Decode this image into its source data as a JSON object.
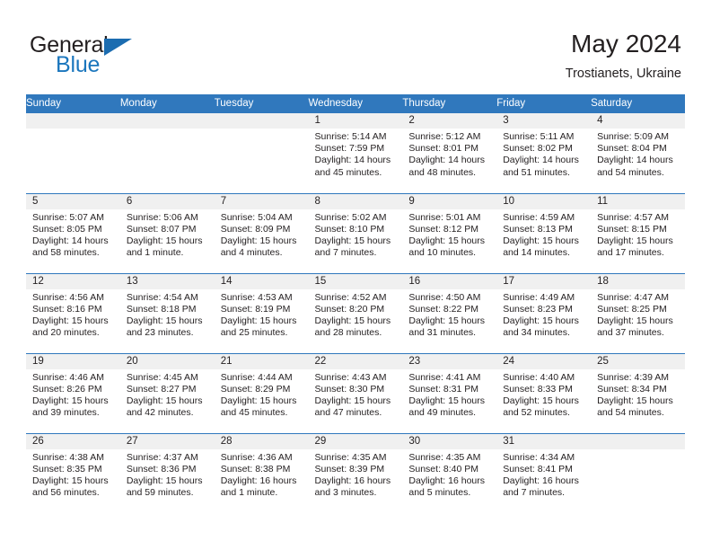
{
  "brand": {
    "name_part1": "General",
    "name_part2": "Blue",
    "flag_icon": "triangle-flag-icon"
  },
  "header": {
    "title": "May 2024",
    "location": "Trostianets, Ukraine"
  },
  "colors": {
    "header_blue": "#3078bd",
    "brand_blue": "#1b76bd",
    "daynum_gray": "#f0f0f0",
    "text": "#231f20"
  },
  "labels": {
    "sunrise_prefix": "Sunrise:",
    "sunset_prefix": "Sunset:",
    "daylight_prefix": "Daylight:"
  },
  "columns": [
    "Sunday",
    "Monday",
    "Tuesday",
    "Wednesday",
    "Thursday",
    "Friday",
    "Saturday"
  ],
  "weeks": [
    [
      {
        "day": "",
        "empty": true
      },
      {
        "day": "",
        "empty": true
      },
      {
        "day": "",
        "empty": true
      },
      {
        "day": "1",
        "sunrise": "Sunrise: 5:14 AM",
        "sunset": "Sunset: 7:59 PM",
        "daylight1": "Daylight: 14 hours",
        "daylight2": "and 45 minutes."
      },
      {
        "day": "2",
        "sunrise": "Sunrise: 5:12 AM",
        "sunset": "Sunset: 8:01 PM",
        "daylight1": "Daylight: 14 hours",
        "daylight2": "and 48 minutes."
      },
      {
        "day": "3",
        "sunrise": "Sunrise: 5:11 AM",
        "sunset": "Sunset: 8:02 PM",
        "daylight1": "Daylight: 14 hours",
        "daylight2": "and 51 minutes."
      },
      {
        "day": "4",
        "sunrise": "Sunrise: 5:09 AM",
        "sunset": "Sunset: 8:04 PM",
        "daylight1": "Daylight: 14 hours",
        "daylight2": "and 54 minutes."
      }
    ],
    [
      {
        "day": "5",
        "sunrise": "Sunrise: 5:07 AM",
        "sunset": "Sunset: 8:05 PM",
        "daylight1": "Daylight: 14 hours",
        "daylight2": "and 58 minutes."
      },
      {
        "day": "6",
        "sunrise": "Sunrise: 5:06 AM",
        "sunset": "Sunset: 8:07 PM",
        "daylight1": "Daylight: 15 hours",
        "daylight2": "and 1 minute."
      },
      {
        "day": "7",
        "sunrise": "Sunrise: 5:04 AM",
        "sunset": "Sunset: 8:09 PM",
        "daylight1": "Daylight: 15 hours",
        "daylight2": "and 4 minutes."
      },
      {
        "day": "8",
        "sunrise": "Sunrise: 5:02 AM",
        "sunset": "Sunset: 8:10 PM",
        "daylight1": "Daylight: 15 hours",
        "daylight2": "and 7 minutes."
      },
      {
        "day": "9",
        "sunrise": "Sunrise: 5:01 AM",
        "sunset": "Sunset: 8:12 PM",
        "daylight1": "Daylight: 15 hours",
        "daylight2": "and 10 minutes."
      },
      {
        "day": "10",
        "sunrise": "Sunrise: 4:59 AM",
        "sunset": "Sunset: 8:13 PM",
        "daylight1": "Daylight: 15 hours",
        "daylight2": "and 14 minutes."
      },
      {
        "day": "11",
        "sunrise": "Sunrise: 4:57 AM",
        "sunset": "Sunset: 8:15 PM",
        "daylight1": "Daylight: 15 hours",
        "daylight2": "and 17 minutes."
      }
    ],
    [
      {
        "day": "12",
        "sunrise": "Sunrise: 4:56 AM",
        "sunset": "Sunset: 8:16 PM",
        "daylight1": "Daylight: 15 hours",
        "daylight2": "and 20 minutes."
      },
      {
        "day": "13",
        "sunrise": "Sunrise: 4:54 AM",
        "sunset": "Sunset: 8:18 PM",
        "daylight1": "Daylight: 15 hours",
        "daylight2": "and 23 minutes."
      },
      {
        "day": "14",
        "sunrise": "Sunrise: 4:53 AM",
        "sunset": "Sunset: 8:19 PM",
        "daylight1": "Daylight: 15 hours",
        "daylight2": "and 25 minutes."
      },
      {
        "day": "15",
        "sunrise": "Sunrise: 4:52 AM",
        "sunset": "Sunset: 8:20 PM",
        "daylight1": "Daylight: 15 hours",
        "daylight2": "and 28 minutes."
      },
      {
        "day": "16",
        "sunrise": "Sunrise: 4:50 AM",
        "sunset": "Sunset: 8:22 PM",
        "daylight1": "Daylight: 15 hours",
        "daylight2": "and 31 minutes."
      },
      {
        "day": "17",
        "sunrise": "Sunrise: 4:49 AM",
        "sunset": "Sunset: 8:23 PM",
        "daylight1": "Daylight: 15 hours",
        "daylight2": "and 34 minutes."
      },
      {
        "day": "18",
        "sunrise": "Sunrise: 4:47 AM",
        "sunset": "Sunset: 8:25 PM",
        "daylight1": "Daylight: 15 hours",
        "daylight2": "and 37 minutes."
      }
    ],
    [
      {
        "day": "19",
        "sunrise": "Sunrise: 4:46 AM",
        "sunset": "Sunset: 8:26 PM",
        "daylight1": "Daylight: 15 hours",
        "daylight2": "and 39 minutes."
      },
      {
        "day": "20",
        "sunrise": "Sunrise: 4:45 AM",
        "sunset": "Sunset: 8:27 PM",
        "daylight1": "Daylight: 15 hours",
        "daylight2": "and 42 minutes."
      },
      {
        "day": "21",
        "sunrise": "Sunrise: 4:44 AM",
        "sunset": "Sunset: 8:29 PM",
        "daylight1": "Daylight: 15 hours",
        "daylight2": "and 45 minutes."
      },
      {
        "day": "22",
        "sunrise": "Sunrise: 4:43 AM",
        "sunset": "Sunset: 8:30 PM",
        "daylight1": "Daylight: 15 hours",
        "daylight2": "and 47 minutes."
      },
      {
        "day": "23",
        "sunrise": "Sunrise: 4:41 AM",
        "sunset": "Sunset: 8:31 PM",
        "daylight1": "Daylight: 15 hours",
        "daylight2": "and 49 minutes."
      },
      {
        "day": "24",
        "sunrise": "Sunrise: 4:40 AM",
        "sunset": "Sunset: 8:33 PM",
        "daylight1": "Daylight: 15 hours",
        "daylight2": "and 52 minutes."
      },
      {
        "day": "25",
        "sunrise": "Sunrise: 4:39 AM",
        "sunset": "Sunset: 8:34 PM",
        "daylight1": "Daylight: 15 hours",
        "daylight2": "and 54 minutes."
      }
    ],
    [
      {
        "day": "26",
        "sunrise": "Sunrise: 4:38 AM",
        "sunset": "Sunset: 8:35 PM",
        "daylight1": "Daylight: 15 hours",
        "daylight2": "and 56 minutes."
      },
      {
        "day": "27",
        "sunrise": "Sunrise: 4:37 AM",
        "sunset": "Sunset: 8:36 PM",
        "daylight1": "Daylight: 15 hours",
        "daylight2": "and 59 minutes."
      },
      {
        "day": "28",
        "sunrise": "Sunrise: 4:36 AM",
        "sunset": "Sunset: 8:38 PM",
        "daylight1": "Daylight: 16 hours",
        "daylight2": "and 1 minute."
      },
      {
        "day": "29",
        "sunrise": "Sunrise: 4:35 AM",
        "sunset": "Sunset: 8:39 PM",
        "daylight1": "Daylight: 16 hours",
        "daylight2": "and 3 minutes."
      },
      {
        "day": "30",
        "sunrise": "Sunrise: 4:35 AM",
        "sunset": "Sunset: 8:40 PM",
        "daylight1": "Daylight: 16 hours",
        "daylight2": "and 5 minutes."
      },
      {
        "day": "31",
        "sunrise": "Sunrise: 4:34 AM",
        "sunset": "Sunset: 8:41 PM",
        "daylight1": "Daylight: 16 hours",
        "daylight2": "and 7 minutes."
      },
      {
        "day": "",
        "empty": true
      }
    ]
  ]
}
